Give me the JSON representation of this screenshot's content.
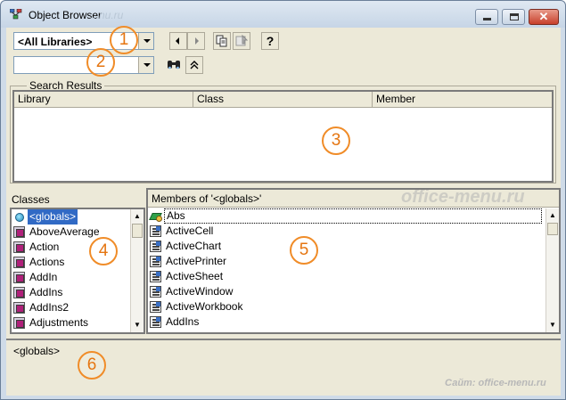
{
  "window": {
    "title": "Object Browser",
    "title_watermark": "...nu.ru"
  },
  "library_combo": {
    "value": "<All Libraries>"
  },
  "search_combo": {
    "value": ""
  },
  "markers": [
    "1",
    "2",
    "3",
    "4",
    "5",
    "6"
  ],
  "search_results": {
    "legend": "Search Results",
    "columns": [
      "Library",
      "Class",
      "Member"
    ]
  },
  "classes": {
    "label": "Classes",
    "items": [
      {
        "label": "<globals>",
        "icon": "globals-icon",
        "selected": true
      },
      {
        "label": "AboveAverage",
        "icon": "class-icon"
      },
      {
        "label": "Action",
        "icon": "class-icon"
      },
      {
        "label": "Actions",
        "icon": "class-icon"
      },
      {
        "label": "AddIn",
        "icon": "class-icon"
      },
      {
        "label": "AddIns",
        "icon": "class-icon"
      },
      {
        "label": "AddIns2",
        "icon": "class-icon"
      },
      {
        "label": "Adjustments",
        "icon": "class-icon"
      }
    ]
  },
  "members": {
    "header": "Members of '<globals>'",
    "watermark": "office-menu.ru",
    "items": [
      {
        "label": "Abs",
        "icon": "function-icon",
        "focused": true
      },
      {
        "label": "ActiveCell",
        "icon": "property-icon"
      },
      {
        "label": "ActiveChart",
        "icon": "property-icon"
      },
      {
        "label": "ActivePrinter",
        "icon": "property-icon"
      },
      {
        "label": "ActiveSheet",
        "icon": "property-icon"
      },
      {
        "label": "ActiveWindow",
        "icon": "property-icon"
      },
      {
        "label": "ActiveWorkbook",
        "icon": "property-icon"
      },
      {
        "label": "AddIns",
        "icon": "property-icon"
      }
    ]
  },
  "details": {
    "text": "<globals>",
    "watermark": "Сайт: office-menu.ru"
  }
}
